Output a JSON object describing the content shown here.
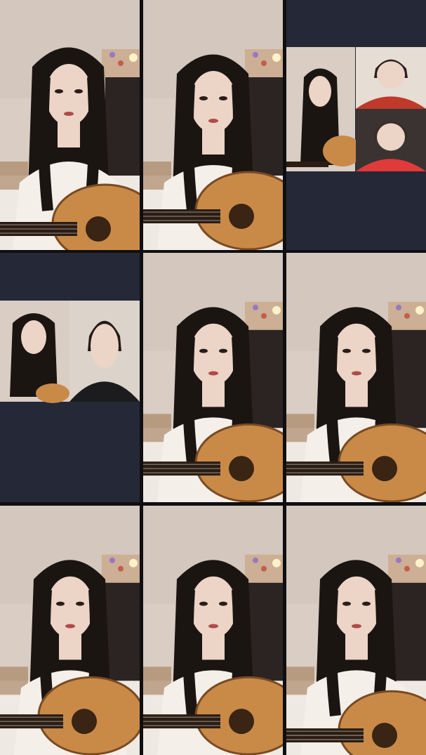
{
  "collage": {
    "tiles": [
      {
        "id": "t1",
        "kind": "solo"
      },
      {
        "id": "t2",
        "kind": "solo"
      },
      {
        "id": "t3",
        "kind": "group-call"
      },
      {
        "id": "t4",
        "kind": "duet-call"
      },
      {
        "id": "t5",
        "kind": "solo"
      },
      {
        "id": "t6",
        "kind": "solo"
      },
      {
        "id": "t7",
        "kind": "solo"
      },
      {
        "id": "t8",
        "kind": "solo"
      },
      {
        "id": "t9",
        "kind": "solo"
      }
    ]
  },
  "colors": {
    "wall": "#d9cdc4",
    "hair": "#1b1512",
    "skin": "#ecd4c6",
    "guitar": "#c98a48",
    "guitar_dark": "#7a4a22",
    "frame_bg": "#252837",
    "cabinet": "#2b2422",
    "couch": "#efe9e3"
  }
}
